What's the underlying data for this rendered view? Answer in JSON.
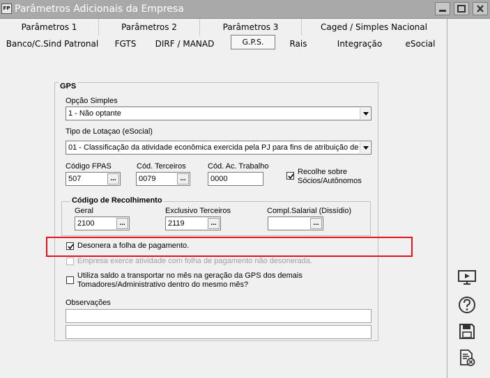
{
  "window": {
    "icon_text": "FP",
    "title": "Parâmetros Adicionais da Empresa"
  },
  "tabs_row1": [
    {
      "label": "Parâmetros 1"
    },
    {
      "label": "Parâmetros 2"
    },
    {
      "label": "Parâmetros 3"
    },
    {
      "label": "Caged / Simples Nacional"
    }
  ],
  "tabs_row2": [
    {
      "label": "Banco/C.Sind Patronal"
    },
    {
      "label": "FGTS"
    },
    {
      "label": "DIRF / MANAD"
    },
    {
      "label": "G.P.S.",
      "active": true
    },
    {
      "label": "Rais"
    },
    {
      "label": "Integração"
    },
    {
      "label": "eSocial"
    }
  ],
  "gps": {
    "frame_label": "GPS",
    "opcao_simples_label": "Opção Simples",
    "opcao_simples_value": "1 - Não optante",
    "tipo_lotacao_label": "Tipo de Lotaçao (eSocial)",
    "tipo_lotacao_value": "01 - Classificação da atividade econômica exercida pela PJ para fins de atribuição de có",
    "codigo_fpas_label": "Código FPAS",
    "codigo_fpas_value": "507",
    "cod_terceiros_label": "Cód. Terceiros",
    "cod_terceiros_value": "0079",
    "cod_ac_trabalho_label": "Cód. Ac. Trabalho",
    "cod_ac_trabalho_value": "0000",
    "recolhe_socios_label_1": "Recolhe sobre",
    "recolhe_socios_label_2": "Sócios/Autônomos",
    "recolhe_socios_checked": true
  },
  "codigo_recolhimento": {
    "frame_label": "Código de Recolhimento",
    "geral_label": "Geral",
    "geral_value": "2100",
    "exclusivo_terceiros_label": "Exclusivo Terceiros",
    "exclusivo_terceiros_value": "2119",
    "compl_salarial_label": "Compl.Salarial (Dissídio)",
    "compl_salarial_value": ""
  },
  "options": {
    "desonera_label": "Desonera a folha de pagamento.",
    "desonera_checked": true,
    "empresa_exerce_label": "Empresa exerce atividade com folha de pagamento não desonerada.",
    "empresa_exerce_checked": false,
    "utiliza_saldo_label_1": "Utiliza saldo a transportar no mês na geração da GPS dos demais",
    "utiliza_saldo_label_2": "Tomadores/Administrativo dentro do mesmo mês?",
    "utiliza_saldo_checked": false
  },
  "observacoes": {
    "label": "Observações",
    "line1": "",
    "line2": ""
  },
  "dot_button_label": "...",
  "highlight_color": "#e0121b",
  "sidebar_icons": [
    "presentation-icon",
    "help-icon",
    "save-icon",
    "cancel-document-icon"
  ]
}
